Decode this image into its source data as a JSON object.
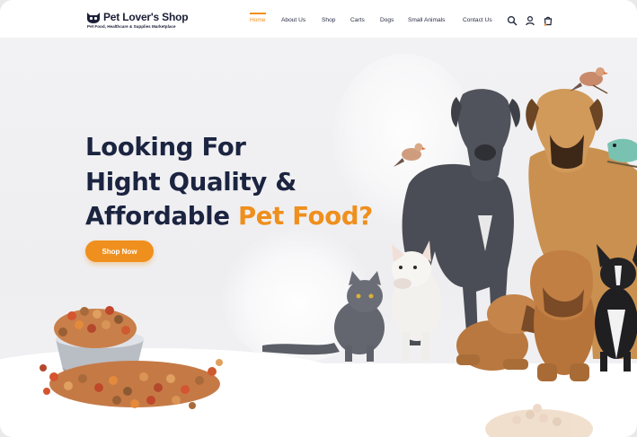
{
  "header": {
    "logo": {
      "title": "Pet Lover's Shop",
      "tagline": "Pet Food, Healthcare & Supplies Marketplace"
    },
    "nav": [
      {
        "label": "Home",
        "active": true
      },
      {
        "label": "About Us",
        "active": false
      },
      {
        "label": "Shop",
        "active": false
      },
      {
        "label": "Carts",
        "active": false
      },
      {
        "label": "Dogs",
        "active": false
      },
      {
        "label": "Small Animals",
        "active": false
      },
      {
        "label": "Contact Us",
        "active": false
      }
    ],
    "icons": [
      "search-icon",
      "user-icon",
      "cart-icon"
    ]
  },
  "hero": {
    "line1": "Looking For",
    "line2": "Hight Quality &",
    "line3_plain": "Affordable ",
    "line3_accent": "Pet Food?",
    "cta_label": "Shop Now"
  },
  "colors": {
    "accent": "#ef8f1d",
    "heading": "#1b2440",
    "background": "#f4f4f6"
  }
}
